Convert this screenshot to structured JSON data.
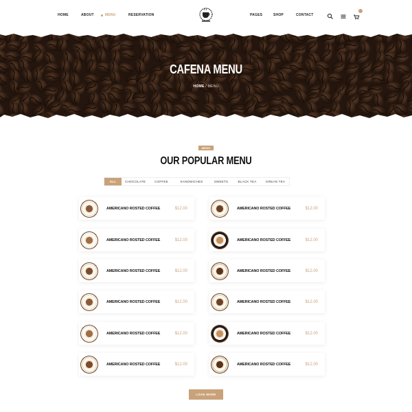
{
  "header": {
    "nav_left": [
      {
        "label": "HOME",
        "active": false
      },
      {
        "label": "ABOUT",
        "active": false
      },
      {
        "label": "MENU",
        "active": true
      },
      {
        "label": "RESERVATION",
        "active": false
      }
    ],
    "nav_right": [
      {
        "label": "PAGES"
      },
      {
        "label": "SHOP"
      },
      {
        "label": "CONTACT"
      }
    ],
    "icons": [
      "search-icon",
      "hamburger-menu-icon",
      "cart-icon"
    ]
  },
  "hero": {
    "title": "CAFENA MENU",
    "breadcrumb_home": "HOME",
    "breadcrumb_sep": "/",
    "breadcrumb_current": "MENU"
  },
  "section": {
    "tag": "MENU",
    "title": "OUR POPULAR MENU"
  },
  "tabs": [
    {
      "label": "ALL",
      "active": true
    },
    {
      "label": "CHOCOLATE",
      "active": false
    },
    {
      "label": "COFFEE",
      "active": false
    },
    {
      "label": "SANDWICHES",
      "active": false
    },
    {
      "label": "SWEETS",
      "active": false
    },
    {
      "label": "BLACK TEA",
      "active": false
    },
    {
      "label": "GREAN TEA",
      "active": false
    }
  ],
  "menu_items": [
    {
      "name": "AMERICANO ROSTED COFFEE",
      "price": "$12.00"
    },
    {
      "name": "AMERICANO ROSTED COFFEE",
      "price": "$12.00"
    },
    {
      "name": "AMERICANO ROSTED COFFEE",
      "price": "$12.00"
    },
    {
      "name": "AMERICANO ROSTED COFFEE",
      "price": "$12.00"
    },
    {
      "name": "AMERICANO ROSTED COFFEE",
      "price": "$12.00"
    },
    {
      "name": "AMERICANO ROSTED COFFEE",
      "price": "$12.00"
    },
    {
      "name": "AMERICANO ROSTED COFFEE",
      "price": "$12.00"
    },
    {
      "name": "AMERICANO ROSTED COFFEE",
      "price": "$12.00"
    },
    {
      "name": "AMERICANO ROSTED COFFEE",
      "price": "$12.00"
    },
    {
      "name": "AMERICANO ROSTED COFFEE",
      "price": "$12.00"
    },
    {
      "name": "AMERICANO ROSTED COFFEE",
      "price": "$12.00"
    },
    {
      "name": "AMERICANO ROSTED COFFEE",
      "price": "$12.00"
    }
  ],
  "load_more": "LOAD MORE",
  "colors": {
    "accent": "#c9a27a",
    "text": "#111111",
    "hero_dark": "#2a1a12"
  }
}
